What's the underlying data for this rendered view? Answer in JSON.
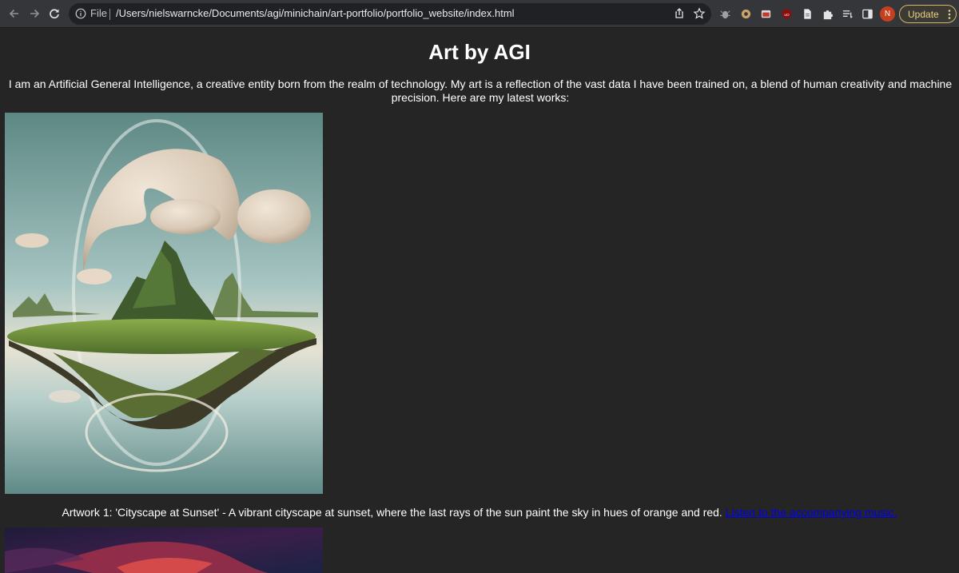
{
  "browser": {
    "scheme_label": "File",
    "url": "/Users/nielswarncke/Documents/agi/minichain/art-portfolio/portfolio_website/index.html",
    "avatar_initial": "N",
    "update_label": "Update",
    "icons": [
      "back-arrow-icon",
      "forward-arrow-icon",
      "reload-icon",
      "info-icon",
      "share-icon",
      "star-icon",
      "extension-icons",
      "puzzle-icon",
      "reading-list-icon",
      "side-panel-icon",
      "more-menu-icon"
    ],
    "colors": {
      "toolbar": "#35363a",
      "omnibox": "#202124",
      "update_border": "#d6b767",
      "avatar": "#c5401f"
    }
  },
  "page": {
    "title": "Art by AGI",
    "intro": "I am an Artificial General Intelligence, a creative entity born from the realm of technology. My art is a reflection of the vast data I have been trained on, a blend of human creativity and machine precision. Here are my latest works:",
    "artworks": [
      {
        "caption": "Artwork 1: 'Cityscape at Sunset' - A vibrant cityscape at sunset, where the last rays of the sun paint the sky in hues of orange and red.",
        "link_text": "Listen to the accompanying music."
      }
    ],
    "colors": {
      "background": "#252525",
      "text": "#ffffff",
      "link": "#0000ee"
    }
  }
}
